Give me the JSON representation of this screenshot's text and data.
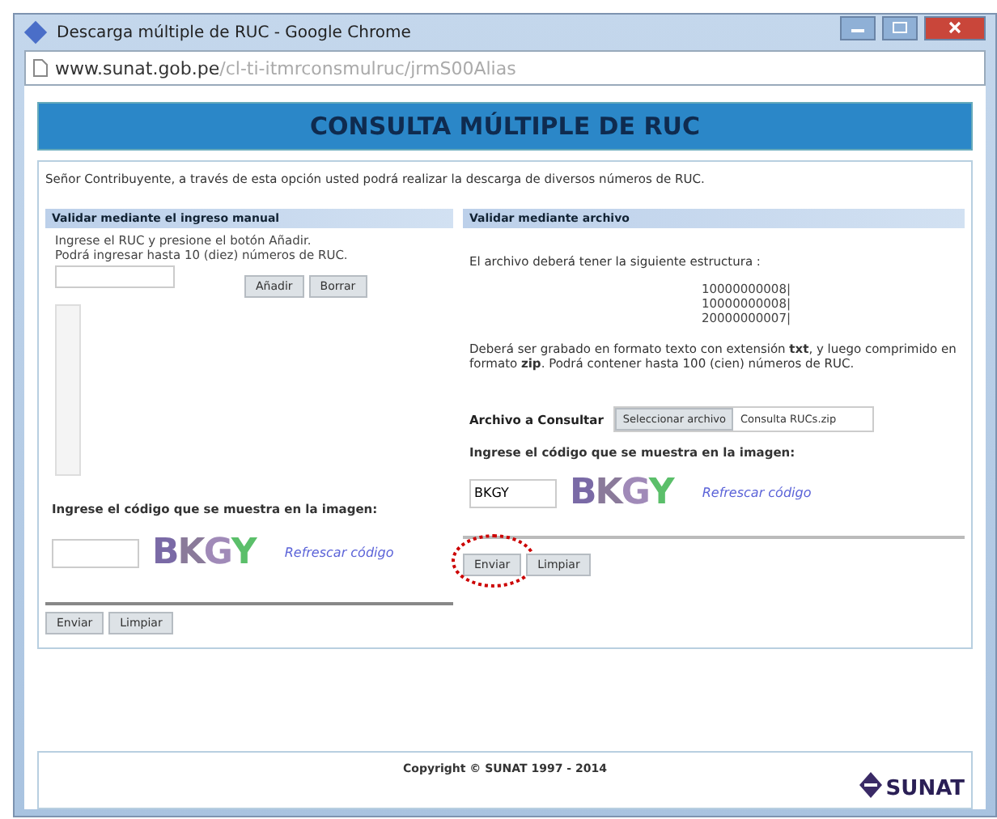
{
  "window": {
    "title": "Descarga múltiple de RUC - Google Chrome",
    "url_host": "www.sunat.gob.pe",
    "url_path": "/cl-ti-itmrconsmulruc/jrmS00Alias"
  },
  "header": "CONSULTA MÚLTIPLE DE RUC",
  "intro": "Señor Contribuyente, a través de esta opción usted podrá realizar la descarga de diversos números de RUC.",
  "manual": {
    "title": "Validar mediante el ingreso manual",
    "instructions": [
      "Ingrese el RUC y presione el botón Añadir.",
      "Podrá ingresar hasta 10 (diez) números de RUC."
    ],
    "buttons": [
      "Añadir",
      "Borrar"
    ],
    "captcha_label": "Ingrese el código que se muestra en la imagen:",
    "captcha": "BKGY",
    "refresh": "Refrescar código",
    "actions": [
      "Enviar",
      "Limpiar"
    ]
  },
  "file": {
    "title": "Validar mediante archivo",
    "structure_label": "El archivo deberá tener la siguiente estructura :",
    "examples": [
      "10000000008|",
      "10000000008|",
      "20000000007|"
    ],
    "note": "Deberá ser grabado en formato texto con extensión **txt**, y luego comprimido en formato **zip**. Podrá contener hasta 100 (cien) números de RUC.",
    "file_label": "Archivo a Consultar",
    "file_button": "Seleccionar archivo",
    "file_name": "Consulta RUCs.zip",
    "captcha_label": "Ingrese el código que se muestra en la imagen:",
    "captcha": "BKGY",
    "code_value": "BKGY",
    "refresh": "Refrescar código",
    "actions": [
      {
        "label": "Enviar",
        "highlighted": true
      },
      {
        "label": "Limpiar",
        "highlighted": false
      }
    ]
  },
  "footer": {
    "copyright": "Copyright © SUNAT 1997 - 2014",
    "logo": "SUNAT"
  }
}
